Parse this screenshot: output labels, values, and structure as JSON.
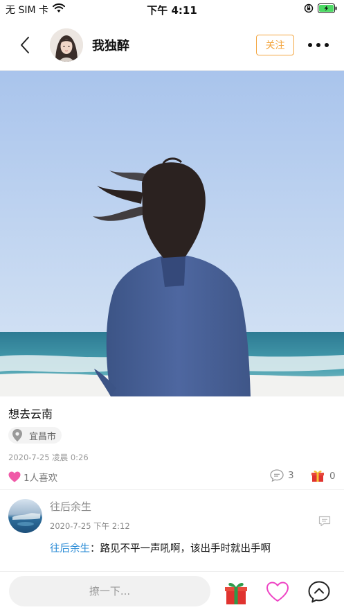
{
  "status_bar": {
    "carrier": "无 SIM 卡",
    "time": "下午 4:11"
  },
  "header": {
    "username": "我独醉",
    "follow_label": "关注",
    "icons": [
      "back-arrow-icon",
      "more-dots-icon"
    ]
  },
  "post": {
    "text": "想去云南",
    "location": "宜昌市",
    "time": "2020-7-25 凌晨 0:26",
    "likes_label": "1人喜欢",
    "comment_count": "3",
    "gift_count": "0"
  },
  "comment": {
    "author": "往后余生",
    "time": "2020-7-25 下午 2:12",
    "reply_author": "往后余生",
    "separator": "：",
    "text": "路见不平一声吼啊，该出手时就出手啊"
  },
  "bottom_bar": {
    "input_placeholder": "撩一下..."
  },
  "colors": {
    "accent_orange": "#f3a640",
    "link_blue": "#2a8bd6",
    "like_pink": "#f05aa8",
    "gift_red": "#e0332f",
    "battery_green": "#4cd964"
  }
}
